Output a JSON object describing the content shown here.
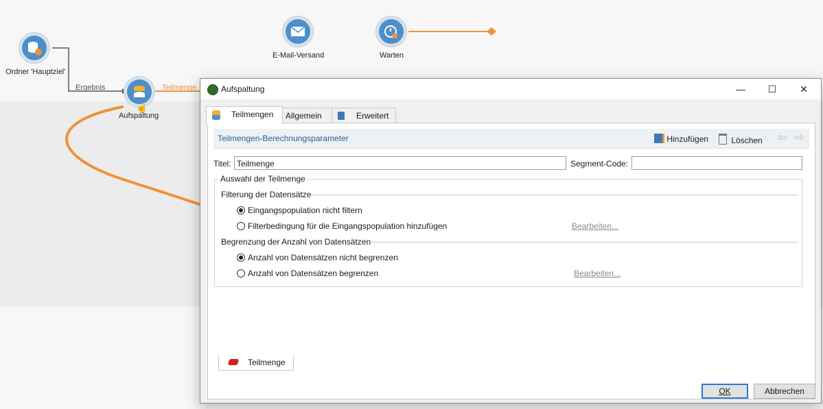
{
  "workflow": {
    "nodes": {
      "ordner": {
        "label": "Ordner 'Hauptziel'"
      },
      "aufspaltung": {
        "label": "Aufspaltung"
      },
      "email": {
        "label": "E-Mail-Versand"
      },
      "warten": {
        "label": "Warten"
      }
    },
    "links": {
      "ergebnis": "Ergebnis",
      "teilmenge": "Teilmenge"
    },
    "colors": {
      "accent": "#f0913a",
      "node": "#4d8fc9"
    }
  },
  "dialog": {
    "title": "Aufspaltung",
    "window_buttons": {
      "minimize": "—",
      "maximize": "☐",
      "close": "✕"
    },
    "tabs": [
      "Teilmengen",
      "Allgemein",
      "Erweitert"
    ],
    "toolbar": {
      "title": "Teilmengen-Berechnungsparameter",
      "add_label": "Hinzufügen",
      "delete_label": "Löschen",
      "prev": "⇦",
      "next": "⇨"
    },
    "form": {
      "title_label": "Titel:",
      "title_value": "Teilmenge",
      "segment_label": "Segment-Code:",
      "segment_value": "",
      "group_label": "Auswahl der Teilmenge",
      "filter_section": "Filterung der Datensätze",
      "filter_opt1": "Eingangspopulation nicht filtern",
      "filter_opt2": "Filterbedingung für die Eingangspopulation hinzufügen",
      "filter_edit": "Bearbeiten...",
      "limit_section": "Begrenzung der Anzahl von Datensätzen",
      "limit_opt1": "Anzahl von Datensätzen nicht begrenzen",
      "limit_opt2": "Anzahl von Datensätzen begrenzen",
      "limit_edit": "Bearbeiten..."
    },
    "bottom_tab": "Teilmenge",
    "ok": "OK",
    "cancel": "Abbrechen"
  }
}
